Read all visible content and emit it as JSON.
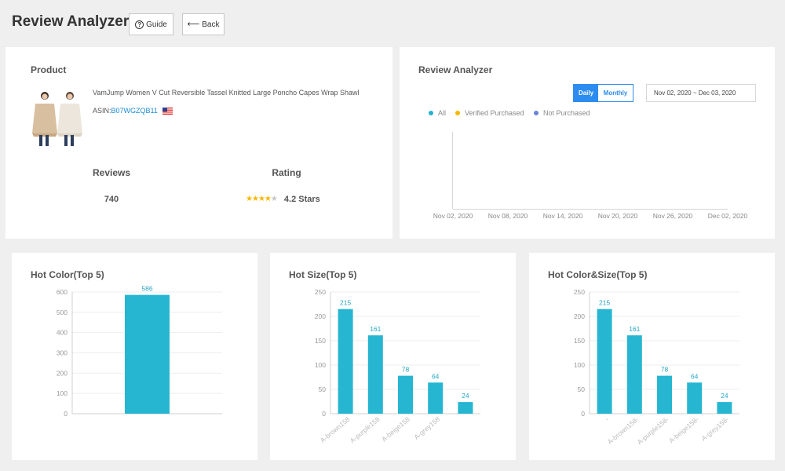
{
  "header": {
    "app_title": "Review Analyzer",
    "guide_label": "Guide",
    "back_label": "Back"
  },
  "product": {
    "card_title": "Product",
    "name": "VamJump Women V Cut Reversible Tassel Knitted Large Poncho Capes Wrap Shawl",
    "asin_label": "ASIN:",
    "asin": "B07WGZQB11",
    "reviews_label": "Reviews",
    "reviews_value": "740",
    "rating_label": "Rating",
    "rating_value": "4.2 Stars",
    "rating_stars": 4
  },
  "analyzer": {
    "card_title": "Review Analyzer",
    "toggle": {
      "daily": "Daily",
      "monthly": "Monthly",
      "selected": "Daily"
    },
    "date_range": "Nov 02, 2020 ~ Dec 03, 2020",
    "legend": [
      {
        "label": "All",
        "color": "#26b0ce"
      },
      {
        "label": "Verified Purchased",
        "color": "#f5b800"
      },
      {
        "label": "Not Purchased",
        "color": "#6a83d8"
      }
    ],
    "x_ticks": [
      "Nov 02, 2020",
      "Nov 08, 2020",
      "Nov 14, 2020",
      "Nov 20, 2020",
      "Nov 26, 2020",
      "Dec 02, 2020"
    ]
  },
  "chart_data": [
    {
      "type": "bar",
      "title": "Hot Color(Top 5)",
      "categories": [
        ""
      ],
      "values": [
        586
      ],
      "ylim": [
        0,
        600
      ],
      "yticks": [
        0,
        100,
        200,
        300,
        400,
        500,
        600
      ],
      "color": "#26b6d1"
    },
    {
      "type": "bar",
      "title": "Hot Size(Top 5)",
      "categories": [
        "A-brown158",
        "A-purple158",
        "A-beige158",
        "A-grey158"
      ],
      "values": [
        215,
        161,
        78,
        64,
        24
      ],
      "ylim": [
        0,
        250
      ],
      "yticks": [
        0,
        50,
        100,
        150,
        200,
        250
      ],
      "color": "#26b6d1"
    },
    {
      "type": "bar",
      "title": "Hot Color&Size(Top 5)",
      "categories": [
        "-",
        "A-brown158-",
        "A-purple158-",
        "A-beige158-",
        "A-grey158-"
      ],
      "values": [
        215,
        161,
        78,
        64,
        24
      ],
      "ylim": [
        0,
        250
      ],
      "yticks": [
        0,
        50,
        100,
        150,
        200,
        250
      ],
      "color": "#26b6d1"
    }
  ]
}
